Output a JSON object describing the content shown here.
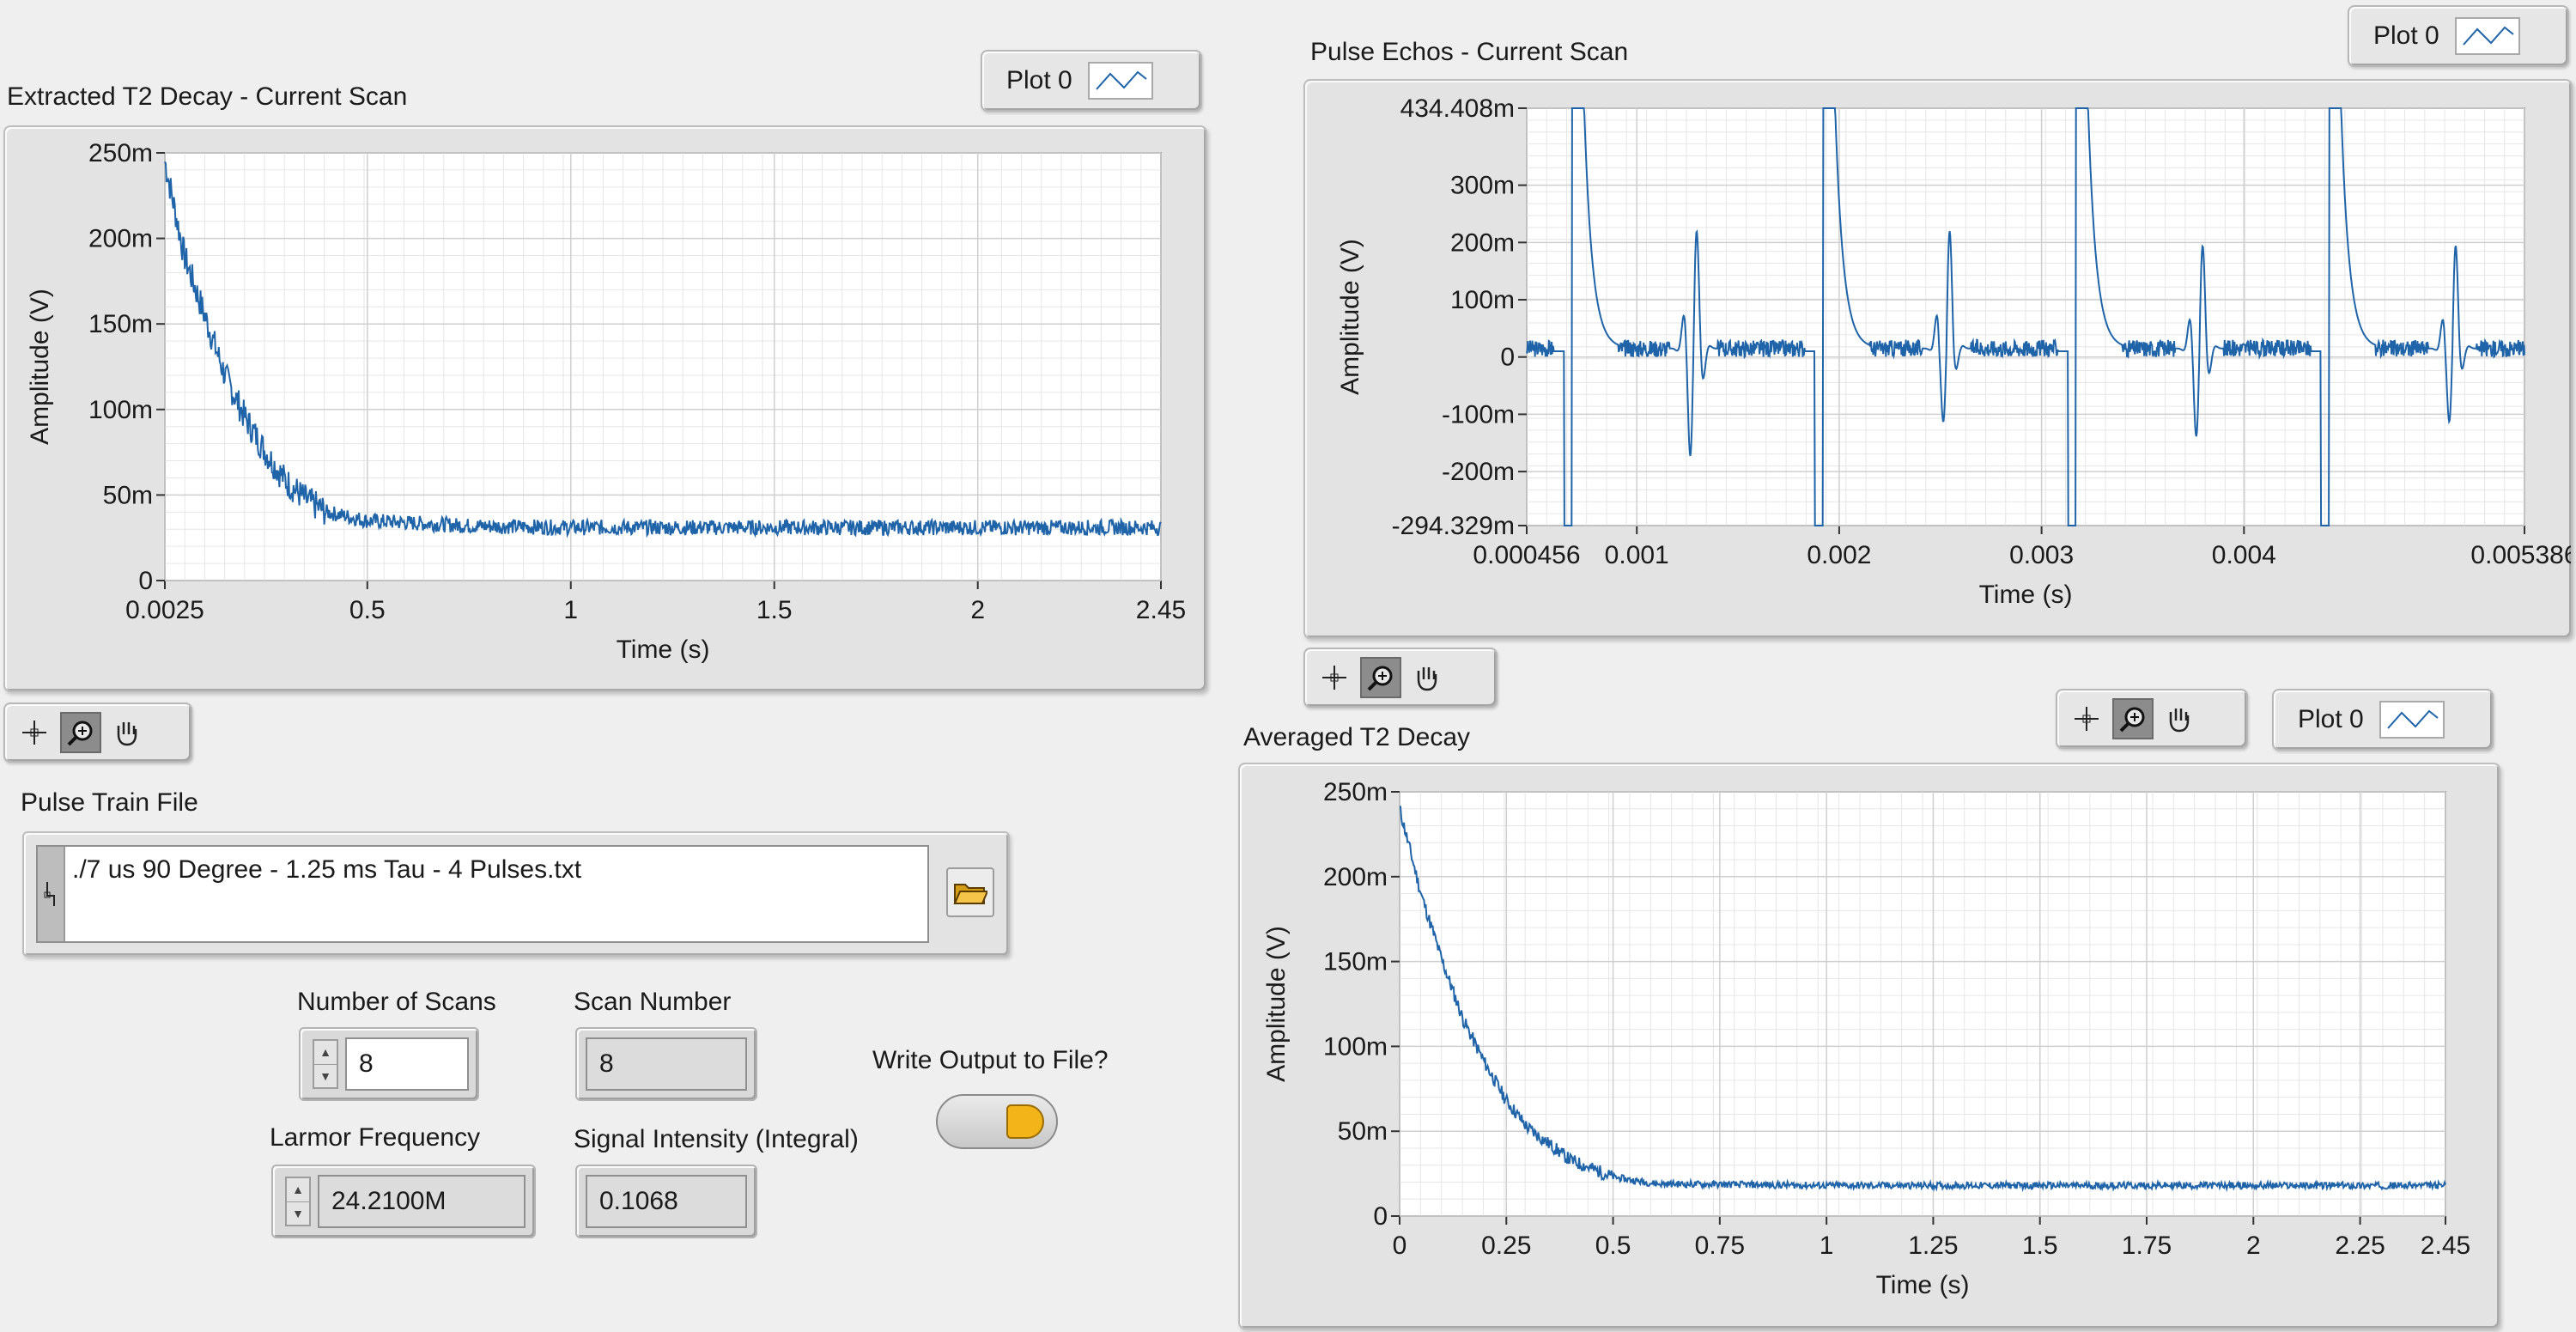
{
  "charts": {
    "t2_current": {
      "title": "Extracted T2 Decay - Current Scan",
      "xlabel": "Time (s)",
      "ylabel": "Amplitude (V)",
      "x_ticks": [
        "0.0025",
        "0.5",
        "1",
        "1.5",
        "2",
        "2.45"
      ],
      "y_ticks": [
        "250m",
        "200m",
        "150m",
        "100m",
        "50m",
        "0"
      ],
      "legend": "Plot 0"
    },
    "pulse_echos": {
      "title": "Pulse Echos - Current Scan",
      "xlabel": "Time (s)",
      "ylabel": "Amplitude (V)",
      "x_ticks": [
        "0.000456",
        "0.001",
        "0.002",
        "0.003",
        "0.004",
        "0.005386"
      ],
      "y_ticks": [
        "434.408m",
        "300m",
        "200m",
        "100m",
        "0",
        "-100m",
        "-200m",
        "-294.329m"
      ],
      "legend": "Plot 0"
    },
    "t2_averaged": {
      "title": "Averaged T2 Decay",
      "xlabel": "Time (s)",
      "ylabel": "Amplitude (V)",
      "x_ticks": [
        "0",
        "0.25",
        "0.5",
        "0.75",
        "1",
        "1.25",
        "1.5",
        "1.75",
        "2",
        "2.25",
        "2.45"
      ],
      "y_ticks": [
        "250m",
        "200m",
        "150m",
        "100m",
        "50m",
        "0"
      ],
      "legend": "Plot 0"
    }
  },
  "controls": {
    "pulse_train_label": "Pulse Train File",
    "pulse_train_path": "./7 us 90 Degree - 1.25 ms Tau - 4 Pulses.txt",
    "num_scans_label": "Number of Scans",
    "num_scans_value": "8",
    "scan_number_label": "Scan Number",
    "scan_number_value": "8",
    "write_output_label": "Write Output to File?",
    "larmor_label": "Larmor Frequency",
    "larmor_value": "24.2100M",
    "signal_label": "Signal Intensity (Integral)",
    "signal_value": "0.1068"
  },
  "colors": {
    "trace": "#1f64a8",
    "led_on": "#f3b41a",
    "grid": "#dcdcdc"
  },
  "chart_data": [
    {
      "type": "line",
      "title": "Extracted T2 Decay - Current Scan",
      "xlabel": "Time (s)",
      "ylabel": "Amplitude (V)",
      "xlim": [
        0.0025,
        2.45
      ],
      "ylim": [
        0,
        0.25
      ],
      "series": [
        {
          "x": [
            0.0025,
            0.05,
            0.1,
            0.15,
            0.2,
            0.25,
            0.3,
            0.35,
            0.4,
            0.5,
            0.75,
            1,
            1.5,
            2,
            2.45
          ],
          "y": [
            0.245,
            0.19,
            0.155,
            0.12,
            0.095,
            0.075,
            0.058,
            0.047,
            0.04,
            0.035,
            0.032,
            0.031,
            0.031,
            0.031,
            0.031
          ]
        }
      ],
      "grid": true
    },
    {
      "type": "line",
      "title": "Pulse Echos - Current Scan",
      "xlabel": "Time (s)",
      "ylabel": "Amplitude (V)",
      "xlim": [
        0.000456,
        0.005386
      ],
      "ylim": [
        -0.294329,
        0.434408
      ],
      "series": [
        {
          "pulse_times": [
            0.00066,
            0.0019,
            0.00315,
            0.0044
          ],
          "echo_times": [
            0.00128,
            0.00253,
            0.00378,
            0.00503
          ],
          "echo_max": [
            0.24,
            0.24,
            0.21,
            0.21
          ],
          "echo_min": [
            -0.22,
            -0.15,
            -0.18,
            -0.15
          ],
          "baseline": 0.015
        }
      ],
      "grid": true
    },
    {
      "type": "line",
      "title": "Averaged T2 Decay",
      "xlabel": "Time (s)",
      "ylabel": "Amplitude (V)",
      "xlim": [
        0,
        2.45
      ],
      "ylim": [
        0,
        0.25
      ],
      "series": [
        {
          "x": [
            0,
            0.05,
            0.1,
            0.15,
            0.2,
            0.25,
            0.3,
            0.4,
            0.5,
            0.6,
            1,
            1.5,
            2,
            2.45
          ],
          "y": [
            0.24,
            0.19,
            0.15,
            0.115,
            0.09,
            0.068,
            0.052,
            0.033,
            0.023,
            0.019,
            0.018,
            0.018,
            0.018,
            0.018
          ]
        }
      ],
      "grid": true
    }
  ]
}
